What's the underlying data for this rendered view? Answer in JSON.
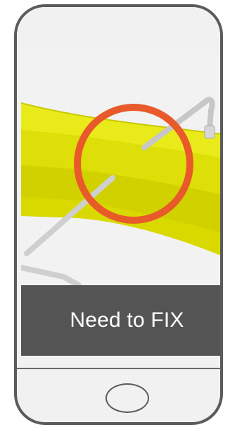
{
  "screen": {
    "caption": "Need to FIX"
  },
  "icons": {
    "home_button": "home-button-circle",
    "highlight": "red-circle-highlight"
  },
  "colors": {
    "phone_frame": "#5b5b5b",
    "phone_body": "#f1f1f1",
    "caption_background": "#545454",
    "caption_text": "#ffffff",
    "highlight_ring": "#e85a2a",
    "beam": "#e6e600"
  }
}
